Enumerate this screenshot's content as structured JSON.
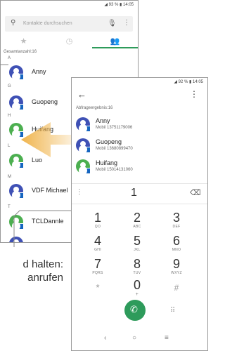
{
  "back": {
    "status": {
      "battery": "93 %",
      "time": "14:05"
    },
    "search_placeholder": "Kontakte durchsuchen",
    "total_label": "Gesamtanzahl:16",
    "sections": [
      {
        "letter": "A",
        "name": "Anny",
        "color": "#3f51b5"
      },
      {
        "letter": "G",
        "name": "Guopeng",
        "color": "#3f51b5"
      },
      {
        "letter": "H",
        "name": "Huifang",
        "color": "#4caf50"
      },
      {
        "letter": "L",
        "name": "Luo",
        "color": "#4caf50"
      },
      {
        "letter": "M",
        "name": "VDF Michael",
        "color": "#3f51b5"
      },
      {
        "letter": "T",
        "name": "TCLDannle",
        "color": "#4caf50"
      }
    ]
  },
  "front": {
    "status": {
      "battery": "92 %",
      "time": "14:05"
    },
    "result_label": "Abfrageergebnis:16",
    "results": [
      {
        "name": "Anny",
        "phone": "Mobil 13751179006",
        "color": "#3f51b5"
      },
      {
        "name": "Guopeng",
        "phone": "Mobil 13680899470",
        "color": "#3f51b5"
      },
      {
        "name": "Huifang",
        "phone": "Mobil 15014131060",
        "color": "#4caf50"
      }
    ],
    "typed": "1",
    "keys": [
      {
        "d": "1",
        "l": "QO"
      },
      {
        "d": "2",
        "l": "ABC"
      },
      {
        "d": "3",
        "l": "DEF"
      },
      {
        "d": "4",
        "l": "GHI"
      },
      {
        "d": "5",
        "l": "JKL"
      },
      {
        "d": "6",
        "l": "MNO"
      },
      {
        "d": "7",
        "l": "PQRS"
      },
      {
        "d": "8",
        "l": "TUV"
      },
      {
        "d": "9",
        "l": "WXYZ"
      },
      {
        "d": "*",
        "l": ""
      },
      {
        "d": "0",
        "l": "+"
      },
      {
        "d": "#",
        "l": ""
      }
    ]
  },
  "caption": {
    "line1": "d halten:",
    "line2": "anrufen"
  },
  "colors": {
    "accent": "#2e9b5b",
    "arrow": "#f0b44c"
  }
}
